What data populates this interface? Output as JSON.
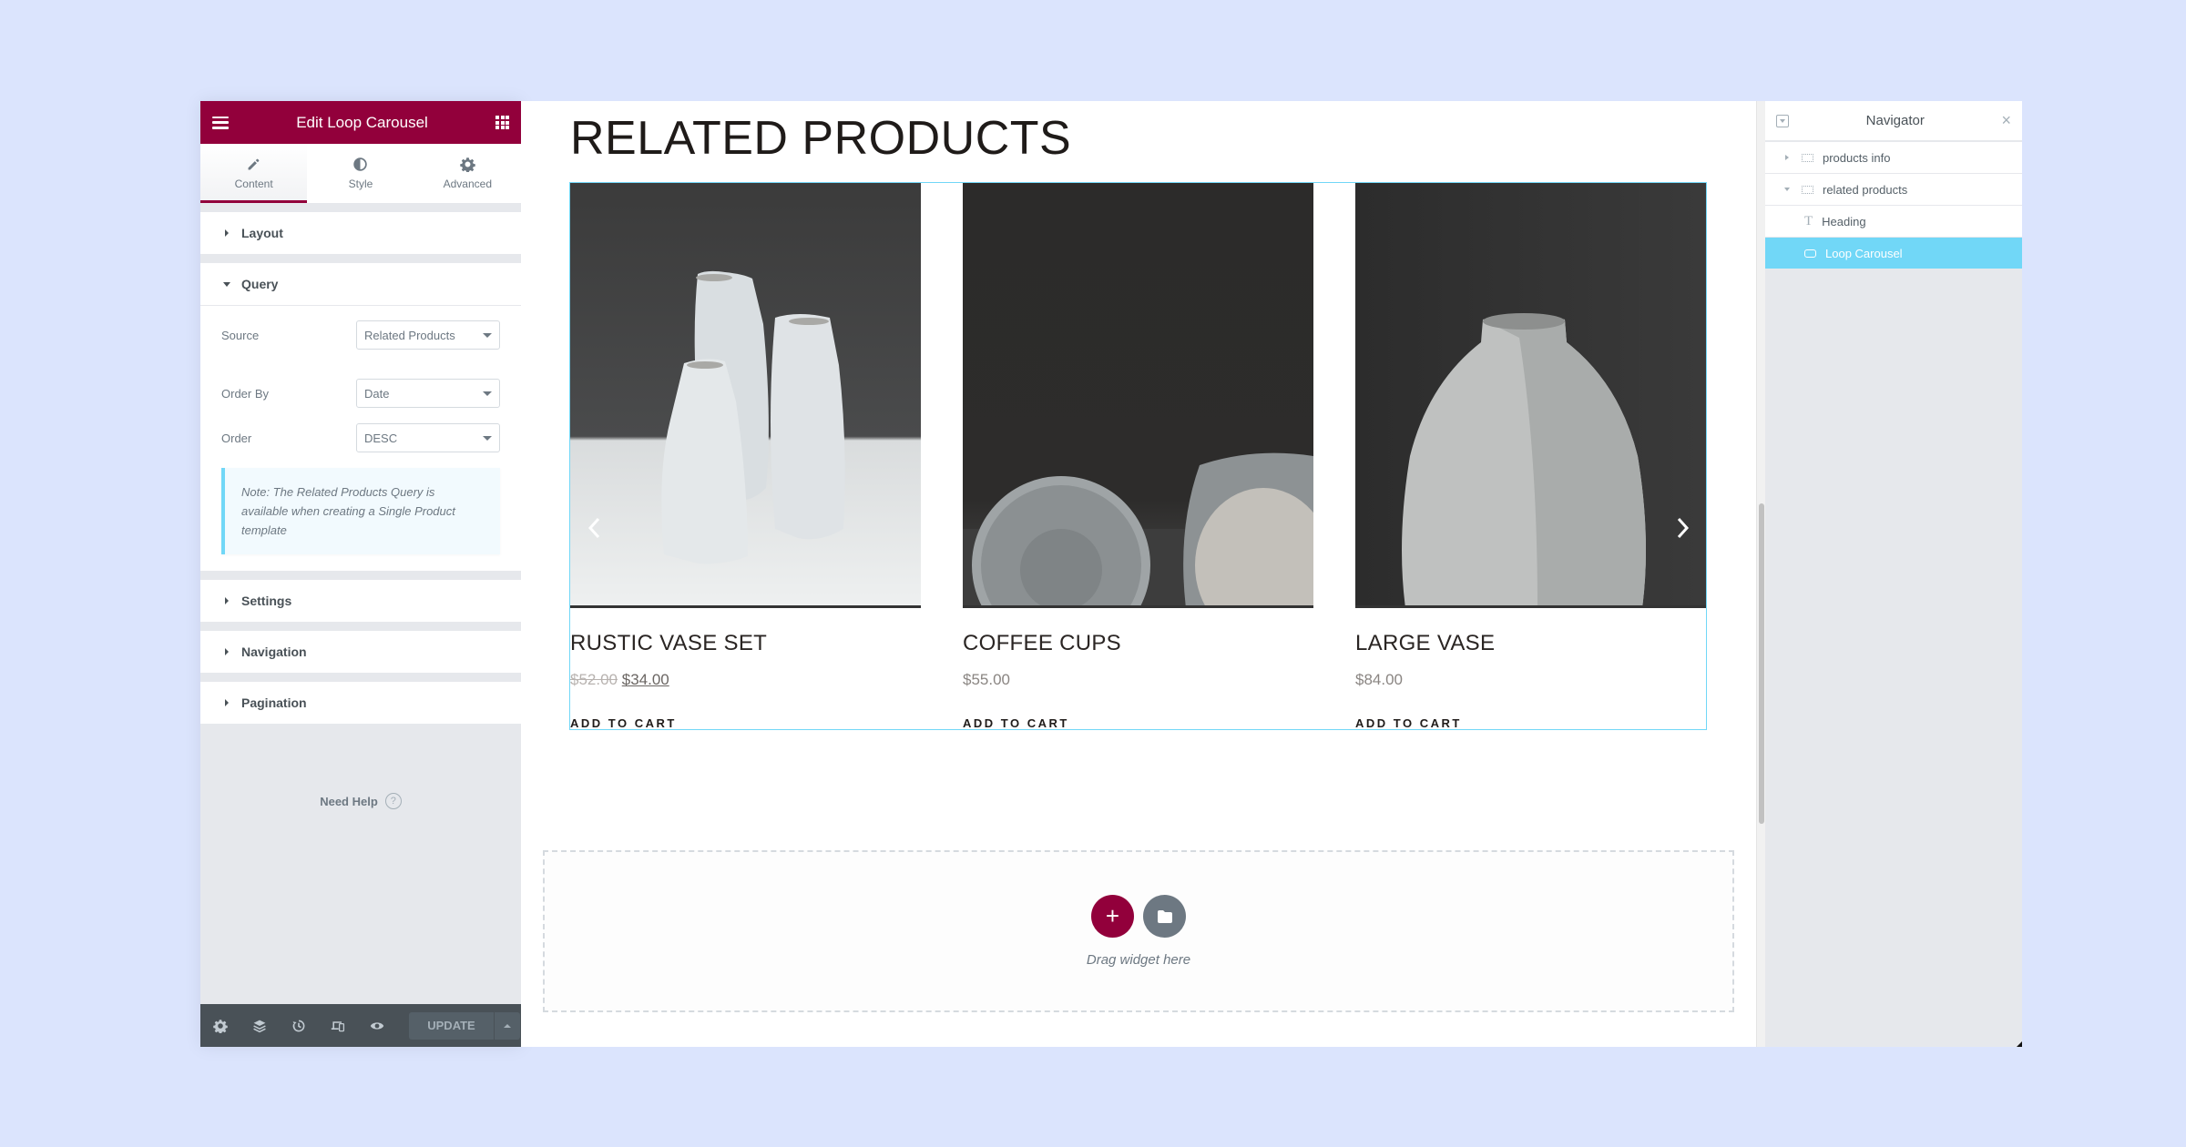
{
  "editor": {
    "title": "Edit Loop Carousel",
    "tabs": [
      {
        "label": "Content",
        "icon": "pencil-icon",
        "active": true
      },
      {
        "label": "Style",
        "icon": "half-circle-icon",
        "active": false
      },
      {
        "label": "Advanced",
        "icon": "gear-icon",
        "active": false
      }
    ],
    "sections": {
      "layout": "Layout",
      "query": "Query",
      "settings": "Settings",
      "navigation": "Navigation",
      "pagination": "Pagination"
    },
    "query": {
      "source_label": "Source",
      "source_value": "Related Products",
      "order_by_label": "Order By",
      "order_by_value": "Date",
      "order_label": "Order",
      "order_value": "DESC",
      "note": "Note: The Related Products Query is available when creating a Single Product template"
    },
    "need_help": "Need Help",
    "footer": {
      "icons": [
        "gear-icon",
        "layers-icon",
        "history-icon",
        "responsive-icon",
        "eye-icon"
      ],
      "update_label": "UPDATE"
    },
    "accent_color": "#92003b"
  },
  "canvas": {
    "heading": "RELATED PRODUCTS",
    "products": [
      {
        "name": "RUSTIC VASE SET",
        "old_price": "$52.00",
        "price": "$34.00",
        "cta": "ADD TO CART",
        "image": "rustic-vase-set-photo"
      },
      {
        "name": "COFFEE CUPS",
        "price": "$55.00",
        "cta": "ADD TO CART",
        "image": "coffee-cups-photo"
      },
      {
        "name": "LARGE VASE",
        "price": "$84.00",
        "cta": "ADD TO CART",
        "image": "large-vase-photo"
      }
    ],
    "dropzone_text": "Drag widget here"
  },
  "navigator": {
    "title": "Navigator",
    "items": [
      {
        "label": "products info",
        "type": "section",
        "expanded": false
      },
      {
        "label": "related products",
        "type": "section",
        "expanded": true
      },
      {
        "label": "Heading",
        "type": "heading-widget"
      },
      {
        "label": "Loop Carousel",
        "type": "loop-carousel-widget",
        "selected": true
      }
    ],
    "selected_color": "#71d7f7"
  }
}
